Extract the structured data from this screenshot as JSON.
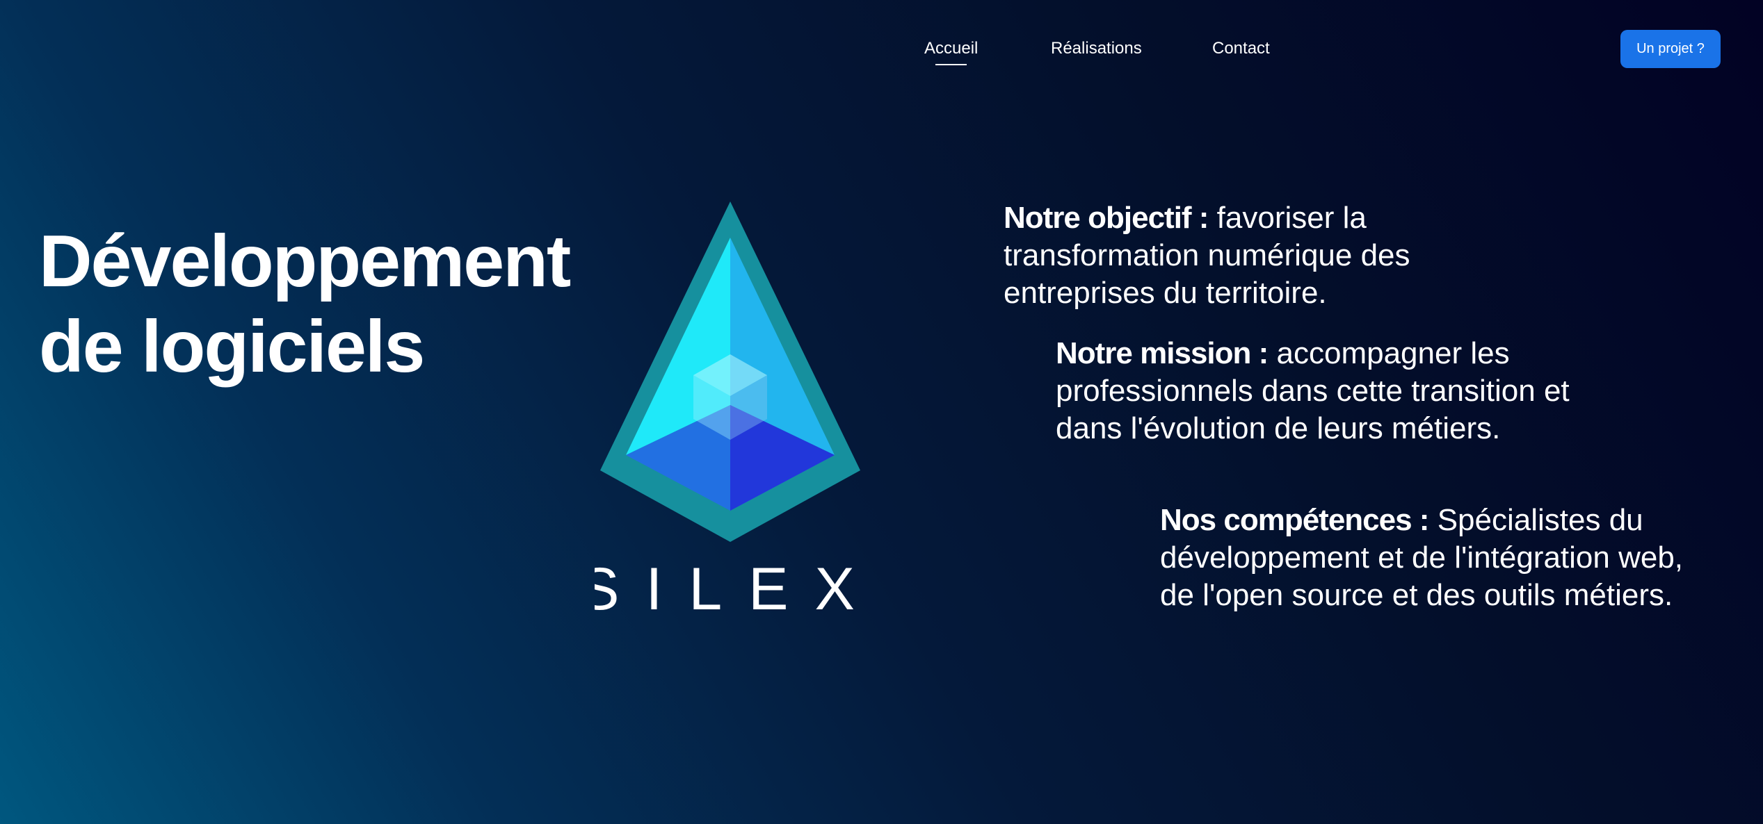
{
  "nav": {
    "links": [
      {
        "label": "Accueil",
        "active": true
      },
      {
        "label": "Réalisations",
        "active": false
      },
      {
        "label": "Contact",
        "active": false
      }
    ],
    "cta_label": "Un projet ?"
  },
  "hero": {
    "title_line1": "Développement",
    "title_line2": "de logiciels"
  },
  "logo": {
    "wordmark": "SILEX",
    "icon": "pyramid-cube-icon"
  },
  "info": {
    "objectif": {
      "heading": "Notre objectif :",
      "line1_rest": " favoriser la",
      "line2": "transformation numérique des",
      "line3": "entreprises du territoire."
    },
    "mission": {
      "heading": "Notre mission :",
      "line1_rest": " accompagner les",
      "line2": "professionnels dans cette transition et",
      "line3": "dans l'évolution de leurs métiers."
    },
    "competences": {
      "heading": "Nos compétences :",
      "line1_rest": " Spécialistes du",
      "line2": "développement et de l'intégration web,",
      "line3": "de l'open source et des outils métiers."
    }
  },
  "colors": {
    "cta": "#1a73e8",
    "background_start": "#00577f",
    "background_end": "#020224"
  }
}
